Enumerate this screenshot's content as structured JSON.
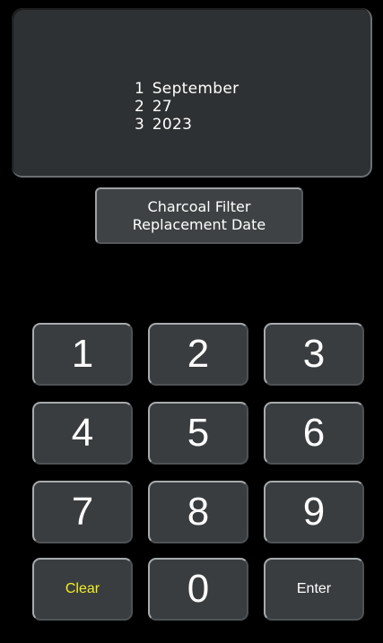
{
  "display": {
    "lines": [
      {
        "num": "1",
        "text": "September"
      },
      {
        "num": "2",
        "text": "27"
      },
      {
        "num": "3",
        "text": "2023"
      }
    ]
  },
  "title_button": {
    "line1": "Charcoal Filter",
    "line2": "Replacement Date"
  },
  "keypad": {
    "keys": [
      "1",
      "2",
      "3",
      "4",
      "5",
      "6",
      "7",
      "8",
      "9"
    ],
    "clear_label": "Clear",
    "zero_label": "0",
    "enter_label": "Enter"
  },
  "colors": {
    "background": "#000000",
    "panel": "#2e3133",
    "key": "#3a3d40",
    "clear_text": "#f2ee24"
  }
}
